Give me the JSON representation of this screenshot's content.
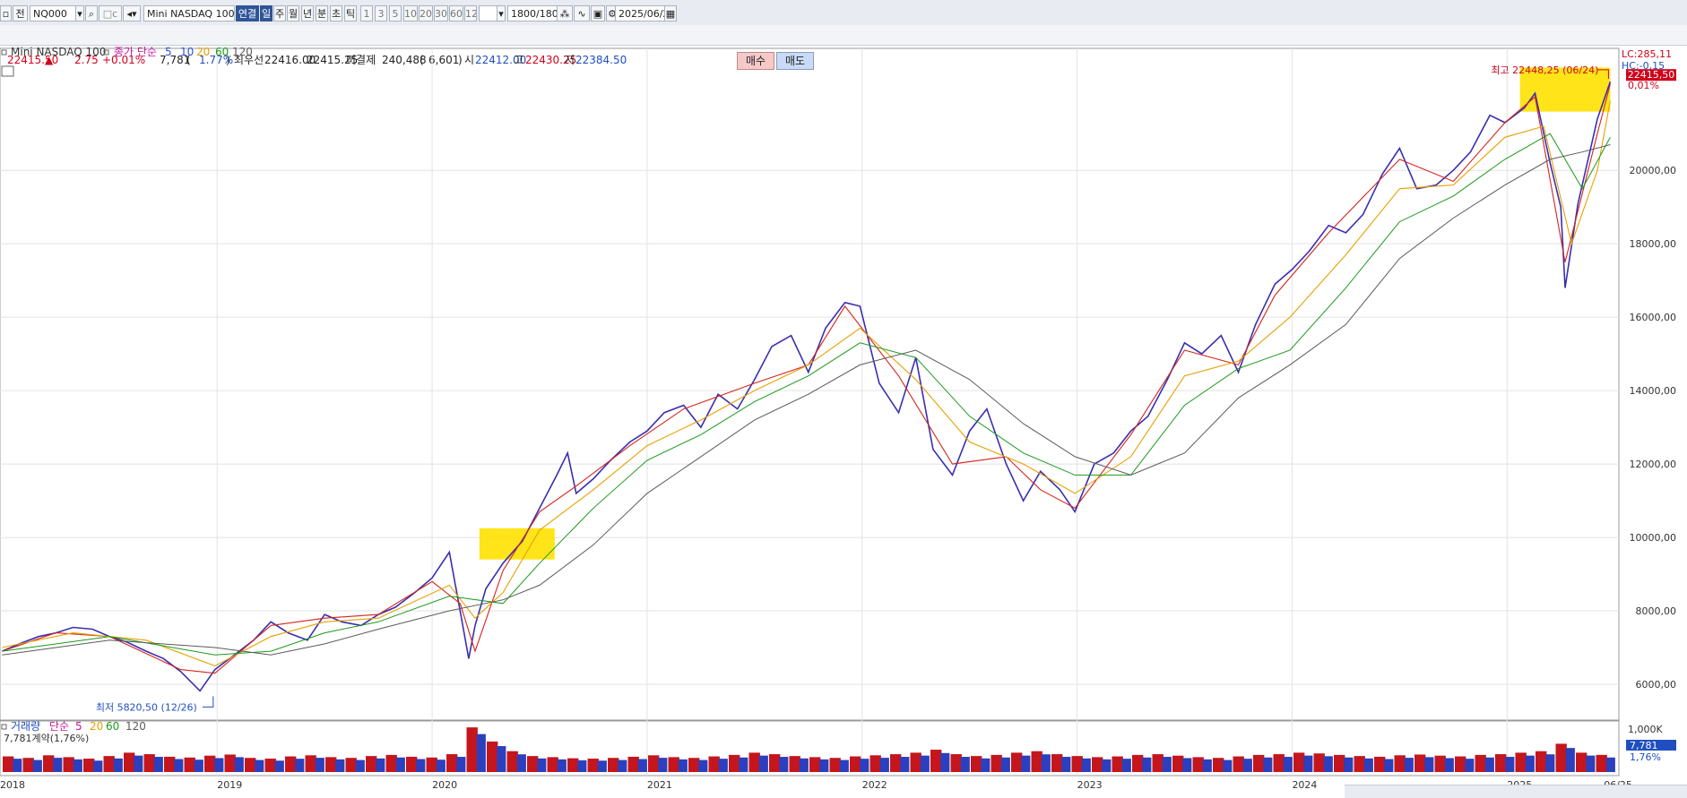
{
  "toolbar": {
    "tab_label": "전",
    "symbol_code": "NQ000",
    "symbol_name": "Mini NASDAQ 100",
    "period_buttons": [
      "연결",
      "일",
      "주",
      "월",
      "년",
      "분",
      "초",
      "틱"
    ],
    "active_period": "일",
    "interval_buttons": [
      "1",
      "3",
      "5",
      "10",
      "20",
      "30",
      "60",
      "120"
    ],
    "count_display": "1800",
    "count_total": "/1800",
    "date": "2025/06/25",
    "icons": [
      "search-icon",
      "sound-icon",
      "chart-type-icon",
      "indicator-icon",
      "save-icon",
      "settings-icon",
      "calendar-icon"
    ]
  },
  "quote": {
    "price": "22415.50",
    "change_arrow": "▲",
    "change": "2.75",
    "change_pct": "+0.01%",
    "volume": "7,781",
    "volume_open": "(",
    "volume_pct": "1.77%",
    "volume_close": ")",
    "best_bid_label": "최우선",
    "best_ask": "22416.00",
    "best_bid": "22415.25",
    "open_interest_label": "미결제",
    "open_interest": "240,488",
    "oi_change_open": "(",
    "oi_change": "6,601",
    "oi_change_close": ")",
    "open_label": "시",
    "open": "22412.00",
    "high_label": "고",
    "high": "22430.25",
    "low_label": "저",
    "low": "22384.50",
    "buy_label": "매수",
    "sell_label": "매도"
  },
  "chart_data": [
    {
      "type": "line",
      "title": "Mini NASDAQ 100",
      "legend": {
        "label": "종가 단순",
        "periods": [
          "5",
          "10",
          "20",
          "60",
          "120"
        ],
        "colors": [
          "#2b4fd8",
          "#e6a100",
          "#1a9a1a",
          "#5a5a5a"
        ],
        "placement": "top-left"
      },
      "x_tick_labels": [
        "2018",
        "2019",
        "2020",
        "2021",
        "2022",
        "2023",
        "2024",
        "2025",
        "06/25"
      ],
      "y_tick_labels": [
        "6000,00",
        "8000,00",
        "10000,00",
        "12000,00",
        "14000,00",
        "16000,00",
        "18000,00",
        "20000,00"
      ],
      "ylim": [
        5000,
        23250
      ],
      "grid": true,
      "series": [
        {
          "name": "종가",
          "x": [
            2018.0,
            2018.08,
            2018.17,
            2018.25,
            2018.33,
            2018.42,
            2018.5,
            2018.58,
            2018.67,
            2018.75,
            2018.83,
            2018.92,
            2018.99,
            2019.08,
            2019.17,
            2019.25,
            2019.33,
            2019.42,
            2019.5,
            2019.58,
            2019.67,
            2019.75,
            2019.83,
            2019.92,
            2020.0,
            2020.08,
            2020.13,
            2020.17,
            2020.2,
            2020.25,
            2020.33,
            2020.42,
            2020.5,
            2020.58,
            2020.63,
            2020.67,
            2020.75,
            2020.83,
            2020.92,
            2021.0,
            2021.08,
            2021.17,
            2021.25,
            2021.33,
            2021.42,
            2021.5,
            2021.58,
            2021.67,
            2021.75,
            2021.83,
            2021.92,
            2021.99,
            2022.08,
            2022.17,
            2022.25,
            2022.33,
            2022.42,
            2022.5,
            2022.58,
            2022.67,
            2022.75,
            2022.83,
            2022.92,
            2022.99,
            2023.08,
            2023.17,
            2023.25,
            2023.33,
            2023.42,
            2023.5,
            2023.58,
            2023.67,
            2023.75,
            2023.83,
            2023.92,
            2024.0,
            2024.08,
            2024.17,
            2024.25,
            2024.33,
            2024.42,
            2024.5,
            2024.58,
            2024.67,
            2024.75,
            2024.83,
            2024.92,
            2024.99,
            2025.08,
            2025.13,
            2025.2,
            2025.25,
            2025.27,
            2025.33,
            2025.42,
            2025.48
          ],
          "values": [
            6900,
            7100,
            7300,
            7400,
            7550,
            7500,
            7300,
            7150,
            6900,
            6700,
            6350,
            5820,
            6400,
            6800,
            7200,
            7700,
            7400,
            7200,
            7900,
            7700,
            7600,
            7900,
            8100,
            8500,
            8900,
            9600,
            8000,
            6700,
            7600,
            8600,
            9300,
            9900,
            10800,
            11700,
            12300,
            11200,
            11600,
            12100,
            12600,
            12900,
            13400,
            13600,
            13000,
            13900,
            13500,
            14300,
            15200,
            15500,
            14500,
            15700,
            16400,
            16300,
            14200,
            13400,
            14900,
            12400,
            11700,
            12900,
            13500,
            12000,
            11000,
            11800,
            11300,
            10700,
            12000,
            12300,
            12900,
            13300,
            14300,
            15300,
            15000,
            15500,
            14500,
            15800,
            16900,
            17300,
            17800,
            18500,
            18300,
            18800,
            19900,
            20600,
            19500,
            19600,
            20000,
            20500,
            21500,
            21300,
            21700,
            22100,
            20200,
            19000,
            16800,
            19100,
            21400,
            22416
          ]
        },
        {
          "name": "5",
          "x": [
            2018.0,
            2018.25,
            2018.5,
            2018.83,
            2018.99,
            2019.25,
            2019.5,
            2019.75,
            2020.0,
            2020.13,
            2020.2,
            2020.33,
            2020.5,
            2020.67,
            2020.92,
            2021.17,
            2021.5,
            2021.75,
            2021.92,
            2022.17,
            2022.42,
            2022.67,
            2022.83,
            2022.99,
            2023.25,
            2023.5,
            2023.75,
            2023.92,
            2024.17,
            2024.5,
            2024.75,
            2024.99,
            2025.13,
            2025.27,
            2025.42,
            2025.48
          ],
          "values": [
            6900,
            7400,
            7300,
            6400,
            6300,
            7600,
            7800,
            7900,
            8800,
            8200,
            6900,
            9100,
            10700,
            11400,
            12500,
            13500,
            14200,
            14700,
            16300,
            14400,
            12000,
            12200,
            11300,
            10800,
            12800,
            15100,
            14700,
            16600,
            18300,
            20300,
            19700,
            21300,
            22000,
            17500,
            21000,
            22350
          ]
        },
        {
          "name": "20",
          "x": [
            2018.0,
            2018.33,
            2018.67,
            2018.99,
            2019.25,
            2019.5,
            2019.75,
            2020.08,
            2020.2,
            2020.33,
            2020.5,
            2020.75,
            2021.0,
            2021.25,
            2021.5,
            2021.75,
            2021.99,
            2022.25,
            2022.5,
            2022.75,
            2022.99,
            2023.25,
            2023.5,
            2023.75,
            2023.99,
            2024.25,
            2024.5,
            2024.75,
            2024.99,
            2025.17,
            2025.3,
            2025.42,
            2025.48
          ],
          "values": [
            7000,
            7400,
            7200,
            6500,
            7300,
            7700,
            7800,
            8700,
            7800,
            8500,
            10200,
            11300,
            12500,
            13200,
            14000,
            14700,
            15700,
            14300,
            12600,
            12000,
            11200,
            12200,
            14400,
            14800,
            16000,
            17700,
            19500,
            19600,
            20900,
            21200,
            18000,
            20000,
            21900
          ]
        },
        {
          "name": "60",
          "x": [
            2018.0,
            2018.5,
            2018.99,
            2019.25,
            2019.5,
            2019.75,
            2020.08,
            2020.33,
            2020.5,
            2020.75,
            2021.0,
            2021.25,
            2021.5,
            2021.75,
            2021.99,
            2022.25,
            2022.5,
            2022.75,
            2022.99,
            2023.25,
            2023.5,
            2023.75,
            2023.99,
            2024.25,
            2024.5,
            2024.75,
            2024.99,
            2025.2,
            2025.35,
            2025.48
          ],
          "values": [
            6900,
            7300,
            6800,
            6900,
            7400,
            7700,
            8400,
            8200,
            9300,
            10800,
            12100,
            12800,
            13700,
            14400,
            15300,
            14900,
            13300,
            12300,
            11700,
            11700,
            13600,
            14600,
            15100,
            16800,
            18600,
            19300,
            20300,
            21000,
            19500,
            20900
          ]
        },
        {
          "name": "120",
          "x": [
            2018.0,
            2018.5,
            2018.99,
            2019.25,
            2019.5,
            2019.75,
            2020.08,
            2020.33,
            2020.5,
            2020.75,
            2021.0,
            2021.25,
            2021.5,
            2021.75,
            2021.99,
            2022.25,
            2022.5,
            2022.75,
            2022.99,
            2023.25,
            2023.5,
            2023.75,
            2023.99,
            2024.25,
            2024.5,
            2024.75,
            2024.99,
            2025.2,
            2025.35,
            2025.48
          ],
          "values": [
            6800,
            7200,
            7000,
            6800,
            7100,
            7500,
            8000,
            8300,
            8700,
            9800,
            11200,
            12200,
            13200,
            13900,
            14700,
            15100,
            14300,
            13100,
            12200,
            11700,
            12300,
            13800,
            14700,
            15800,
            17600,
            18700,
            19600,
            20300,
            20500,
            20700
          ]
        }
      ],
      "annotations": [
        {
          "text": "최저 5820,50 (12/26)",
          "x": 2018.99,
          "y": 5820
        },
        {
          "text": "최고 22448,25 (06/24)",
          "x": 2025.48,
          "y": 22448
        }
      ],
      "highlights": [
        {
          "x": [
            2020.22,
            2020.57
          ],
          "y": [
            9400,
            10250
          ],
          "color": "#ffe100"
        },
        {
          "x": [
            2025.06,
            2025.48
          ],
          "y": [
            21600,
            22800
          ],
          "color": "#ffe100"
        }
      ],
      "right_axis": {
        "lc_label": "LC:285,11",
        "hc_label": "HC:-0,15",
        "last_price": "22415,50",
        "last_pct": "0,01%"
      }
    },
    {
      "type": "bar",
      "title": "거래량",
      "legend": {
        "label": "단순",
        "periods": [
          "5",
          "20",
          "60",
          "120"
        ]
      },
      "subtitle": "7,781계약(1,76%)",
      "y_tick_labels": [
        "1,000K"
      ],
      "ylim": [
        0,
        1300
      ],
      "right_axis": {
        "last_value": "7,781",
        "last_pct": "1,76%"
      },
      "values_thousands": [
        420,
        380,
        450,
        400,
        360,
        430,
        520,
        480,
        410,
        390,
        440,
        470,
        380,
        360,
        420,
        450,
        400,
        380,
        430,
        460,
        410,
        390,
        480,
        1200,
        820,
        560,
        430,
        400,
        370,
        360,
        380,
        410,
        450,
        400,
        380,
        420,
        460,
        520,
        480,
        430,
        400,
        380,
        420,
        450,
        480,
        520,
        600,
        480,
        430,
        460,
        520,
        560,
        480,
        430,
        400,
        420,
        460,
        480,
        440,
        400,
        380,
        420,
        460,
        480,
        520,
        500,
        460,
        430,
        410,
        450,
        470,
        440,
        420,
        460,
        480,
        520,
        560,
        760,
        520,
        460
      ]
    }
  ]
}
